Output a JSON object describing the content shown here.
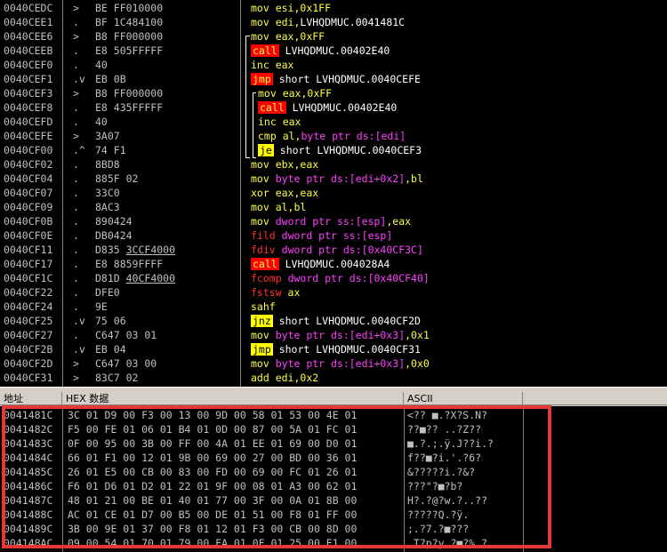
{
  "disasm": [
    {
      "addr": "0040CEDC",
      "mark": ">",
      "hex": "BE FF010000",
      "asm": [
        [
          "mn",
          "mov"
        ],
        [
          "op",
          " esi,0x1FF"
        ]
      ]
    },
    {
      "addr": "0040CEE1",
      "mark": ".",
      "hex": "BF 1C484100",
      "asm": [
        [
          "mn",
          "mov"
        ],
        [
          "op",
          " edi,"
        ],
        [
          "target",
          "LVHQDMUC.0041481C"
        ]
      ]
    },
    {
      "addr": "0040CEE6",
      "mark": ">",
      "hex": "B8 FF000000",
      "asm": [
        [
          "mn",
          "mov"
        ],
        [
          "op",
          " eax,0xFF"
        ]
      ]
    },
    {
      "addr": "0040CEEB",
      "mark": ".",
      "hex": "E8 505FFFFF",
      "asm": [
        [
          "mn-red",
          "call"
        ],
        [
          "target",
          " LVHQDMUC.00402E40"
        ]
      ]
    },
    {
      "addr": "0040CEF0",
      "mark": ".",
      "hex": "40",
      "asm": [
        [
          "mn",
          "inc"
        ],
        [
          "op",
          " eax"
        ]
      ]
    },
    {
      "addr": "0040CEF1",
      "mark": ".v",
      "hex": "EB 0B",
      "asm": [
        [
          "mn-red",
          "jmp"
        ],
        [
          "target",
          " short LVHQDMUC.0040CEFE"
        ]
      ]
    },
    {
      "addr": "0040CEF3",
      "mark": ">",
      "hex": "B8 FF000000",
      "asm": [
        [
          "mn",
          "mov"
        ],
        [
          "op",
          " eax,0xFF"
        ]
      ]
    },
    {
      "addr": "0040CEF8",
      "mark": ".",
      "hex": "E8 435FFFFF",
      "asm": [
        [
          "mn-red",
          "call"
        ],
        [
          "target",
          " LVHQDMUC.00402E40"
        ]
      ]
    },
    {
      "addr": "0040CEFD",
      "mark": ".",
      "hex": "40",
      "asm": [
        [
          "mn",
          "inc"
        ],
        [
          "op",
          " eax"
        ]
      ]
    },
    {
      "addr": "0040CEFE",
      "mark": ">",
      "hex": "3A07",
      "asm": [
        [
          "mn",
          "cmp"
        ],
        [
          "op",
          " al,"
        ],
        [
          "kw",
          "byte ptr ds:[edi]"
        ]
      ]
    },
    {
      "addr": "0040CF00",
      "mark": ".^",
      "hex": "74 F1",
      "asm": [
        [
          "mn-yel",
          "je"
        ],
        [
          "target",
          " short LVHQDMUC.0040CEF3"
        ]
      ]
    },
    {
      "addr": "0040CF02",
      "mark": ".",
      "hex": "8BD8",
      "asm": [
        [
          "mn",
          "mov"
        ],
        [
          "op",
          " ebx,eax"
        ]
      ]
    },
    {
      "addr": "0040CF04",
      "mark": ".",
      "hex": "885F 02",
      "asm": [
        [
          "mn",
          "mov"
        ],
        [
          "op",
          " "
        ],
        [
          "kw",
          "byte ptr ds:[edi+0x2]"
        ],
        [
          "op",
          ",bl"
        ]
      ]
    },
    {
      "addr": "0040CF07",
      "mark": ".",
      "hex": "33C0",
      "asm": [
        [
          "mn",
          "xor"
        ],
        [
          "op",
          " eax,eax"
        ]
      ]
    },
    {
      "addr": "0040CF09",
      "mark": ".",
      "hex": "8AC3",
      "asm": [
        [
          "mn",
          "mov"
        ],
        [
          "op",
          " al,bl"
        ]
      ]
    },
    {
      "addr": "0040CF0B",
      "mark": ".",
      "hex": "890424",
      "asm": [
        [
          "mn",
          "mov"
        ],
        [
          "op",
          " "
        ],
        [
          "kw",
          "dword ptr ss:[esp]"
        ],
        [
          "op",
          ",eax"
        ]
      ]
    },
    {
      "addr": "0040CF0E",
      "mark": ".",
      "hex": "DB0424",
      "asm": [
        [
          "mn-fpu",
          "fild"
        ],
        [
          "op",
          " "
        ],
        [
          "kw",
          "dword ptr ss:[esp]"
        ]
      ]
    },
    {
      "addr": "0040CF11",
      "mark": ".",
      "hex": "D835 3CCF4000",
      "asm": [
        [
          "mn-fpu",
          "fdiv"
        ],
        [
          "op",
          " "
        ],
        [
          "kw",
          "dword ptr ds:[0x40CF3C]"
        ]
      ]
    },
    {
      "addr": "0040CF17",
      "mark": ".",
      "hex": "E8 8859FFFF",
      "asm": [
        [
          "mn-red",
          "call"
        ],
        [
          "target",
          " LVHQDMUC.004028A4"
        ]
      ]
    },
    {
      "addr": "0040CF1C",
      "mark": ".",
      "hex": "D81D 40CF4000",
      "asm": [
        [
          "mn-fpu",
          "fcomp"
        ],
        [
          "op",
          " "
        ],
        [
          "kw",
          "dword ptr ds:[0x40CF40]"
        ]
      ]
    },
    {
      "addr": "0040CF22",
      "mark": ".",
      "hex": "DFE0",
      "asm": [
        [
          "mn-fpu",
          "fstsw"
        ],
        [
          "op",
          " ax"
        ]
      ]
    },
    {
      "addr": "0040CF24",
      "mark": ".",
      "hex": "9E",
      "asm": [
        [
          "mn",
          "sahf"
        ]
      ]
    },
    {
      "addr": "0040CF25",
      "mark": ".v",
      "hex": "75 06",
      "asm": [
        [
          "mn-yel",
          "jnz"
        ],
        [
          "target",
          " short LVHQDMUC.0040CF2D"
        ]
      ]
    },
    {
      "addr": "0040CF27",
      "mark": ".",
      "hex": "C647 03 01",
      "asm": [
        [
          "mn",
          "mov"
        ],
        [
          "op",
          " "
        ],
        [
          "kw",
          "byte ptr ds:[edi+0x3]"
        ],
        [
          "op",
          ",0x1"
        ]
      ]
    },
    {
      "addr": "0040CF2B",
      "mark": ".v",
      "hex": "EB 04",
      "asm": [
        [
          "mn-yel",
          "jmp"
        ],
        [
          "target",
          " short LVHQDMUC.0040CF31"
        ]
      ]
    },
    {
      "addr": "0040CF2D",
      "mark": ">",
      "hex": "C647 03 00",
      "asm": [
        [
          "mn",
          "mov"
        ],
        [
          "op",
          " "
        ],
        [
          "kw",
          "byte ptr ds:[edi+0x3]"
        ],
        [
          "op",
          ",0x0"
        ]
      ]
    },
    {
      "addr": "0040CF31",
      "mark": ">",
      "hex": "83C7 02",
      "asm": [
        [
          "mn",
          "add"
        ],
        [
          "op",
          " edi,0x2"
        ]
      ]
    }
  ],
  "dump_header": {
    "addr": "地址",
    "hex": "HEX 数据",
    "ascii": "ASCII"
  },
  "dump": [
    {
      "addr": "0041481C",
      "hex": "3C 01 D9 00 F3 00 13 00 9D 00 58 01 53 00 4E 01",
      "ascii": "<?? ■.?X?S.N?"
    },
    {
      "addr": "0041482C",
      "hex": "F5 00 FE 01 06 01 B4 01 0D 00 87 00 5A 01 FC 01",
      "ascii": "??■?? ..?Z??"
    },
    {
      "addr": "0041483C",
      "hex": "0F 00 95 00 3B 00 FF 00 4A 01 EE 01 69 00 D0 01",
      "ascii": "■.?.;.ÿ.J??i.?"
    },
    {
      "addr": "0041484C",
      "hex": "66 01 F1 00 12 01 9B 00 69 00 27 00 BD 00 36 01",
      "ascii": "f??■?i.'.?6?"
    },
    {
      "addr": "0041485C",
      "hex": "26 01 E5 00 CB 00 83 00 FD 00 69 00 FC 01 26 01",
      "ascii": "&?????i.?&?"
    },
    {
      "addr": "0041486C",
      "hex": "F6 01 D6 01 D2 01 22 01 9F 00 08 01 A3 00 62 01",
      "ascii": "???\"?■?b?"
    },
    {
      "addr": "0041487C",
      "hex": "48 01 21 00 BE 01 40 01 77 00 3F 00 0A 01 8B 00",
      "ascii": "H?.?@?w.?..??"
    },
    {
      "addr": "0041488C",
      "hex": "AC 01 CE 01 D7 00 B5 00 DE 01 51 00 F8 01 FF 00",
      "ascii": "?????Q.?ÿ."
    },
    {
      "addr": "0041489C",
      "hex": "3B 00 9E 01 37 00 F8 01 12 01 F3 00 CB 00 8D 00",
      "ascii": ";.?7.?■???"
    },
    {
      "addr": "004148AC",
      "hex": "09 00 54 01 70 01 79 00 FA 01 0F 01 25 00 E1 00",
      "ascii": ".T?p?y.?■?%.?"
    }
  ]
}
